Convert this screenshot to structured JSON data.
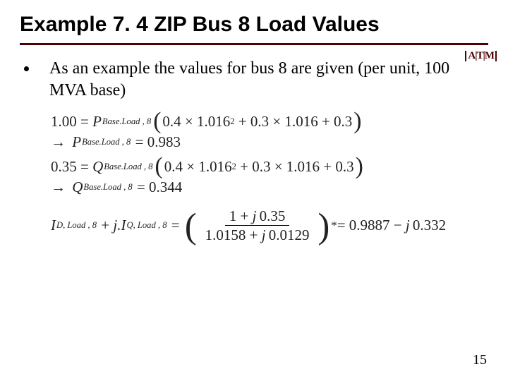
{
  "title": "Example 7. 4 ZIP Bus 8 Load Values",
  "logo": {
    "text": "A|T|M",
    "aria": "Texas A&M logo"
  },
  "bullet": "As an example the values for bus 8 are given (per unit, 100 MVA base)",
  "eq": {
    "p_lhs": "1.00",
    "p_sym": "P",
    "p_sub": "Base.Load , 8",
    "poly_a": "0.4",
    "poly_v": "1.016",
    "poly_sq": "2",
    "poly_b": "0.3",
    "poly_c": "0.3",
    "p_val": "0.983",
    "q_lhs": "0.35",
    "q_sym": "Q",
    "q_sub": "Base.Load , 8",
    "q_val": "0.344",
    "i_sym": "I",
    "i_sub_d": "D, Load , 8",
    "i_sub_q": "Q, Load , 8",
    "plus_ji": "j.",
    "frac_num_a": "1",
    "frac_num_jb": "0.35",
    "frac_den_a": "1.0158",
    "frac_den_jb": "0.0129",
    "star": "*",
    "i_res_a": "0.9887",
    "i_res_b": "0.332"
  },
  "page": "15"
}
